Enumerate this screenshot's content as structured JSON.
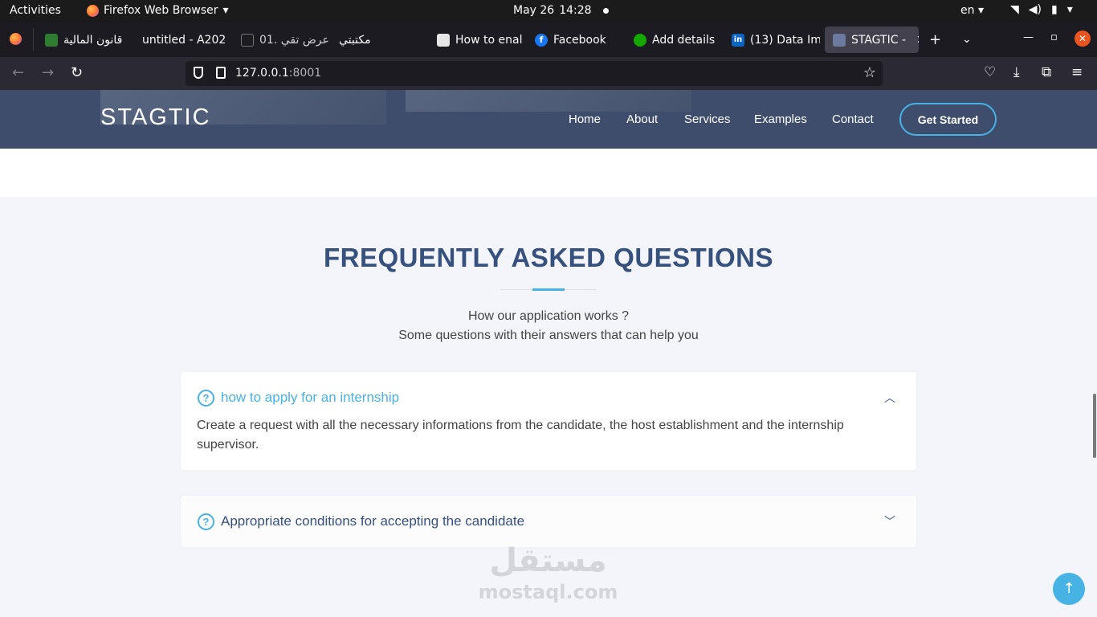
{
  "system_bar": {
    "activities": "Activities",
    "app_name": "Firefox Web Browser",
    "date": "May 26",
    "time": "14:28",
    "lang": "en"
  },
  "tabs": [
    {
      "title": "قانون المالية",
      "fav_color": "#2e7d32"
    },
    {
      "title": "untitled - A202",
      "fav_color": ""
    },
    {
      "title": "01. عرض تقي",
      "fav_color": ""
    },
    {
      "title": "مكتبتي",
      "fav_color": ""
    },
    {
      "title": "How to enal",
      "fav_color": "#e6e6e6"
    },
    {
      "title": "Facebook",
      "fav_color": "#1877f2"
    },
    {
      "title": "Add details",
      "fav_color": "#14a800"
    },
    {
      "title": "(13) Data Im",
      "fav_color": "#0a66c2"
    },
    {
      "title": "STAGTIC -",
      "fav_color": "#6c7aa0",
      "active": true
    }
  ],
  "address_bar": {
    "host": "127.0.0.1",
    "port": ":8001"
  },
  "site": {
    "logo": "STAGTIC",
    "nav": [
      "Home",
      "About",
      "Services",
      "Examples",
      "Contact"
    ],
    "cta": "Get Started"
  },
  "faq": {
    "title": "FREQUENTLY ASKED QUESTIONS",
    "subtitle_1": "How our application works ?",
    "subtitle_2": "Some questions with their answers that can help you",
    "items": [
      {
        "question": "how to apply for an internship",
        "answer": "Create a request with all the necessary informations from the candidate, the host establishment and the internship supervisor.",
        "expanded": true
      },
      {
        "question": "Appropriate conditions for accepting the candidate",
        "answer": "",
        "expanded": false
      }
    ]
  },
  "watermark": {
    "arabic": "مستقل",
    "latin": "mostaql.com"
  },
  "colors": {
    "accent": "#47b2e4",
    "heading": "#37517e",
    "header_bg": "#3d4d6b"
  }
}
